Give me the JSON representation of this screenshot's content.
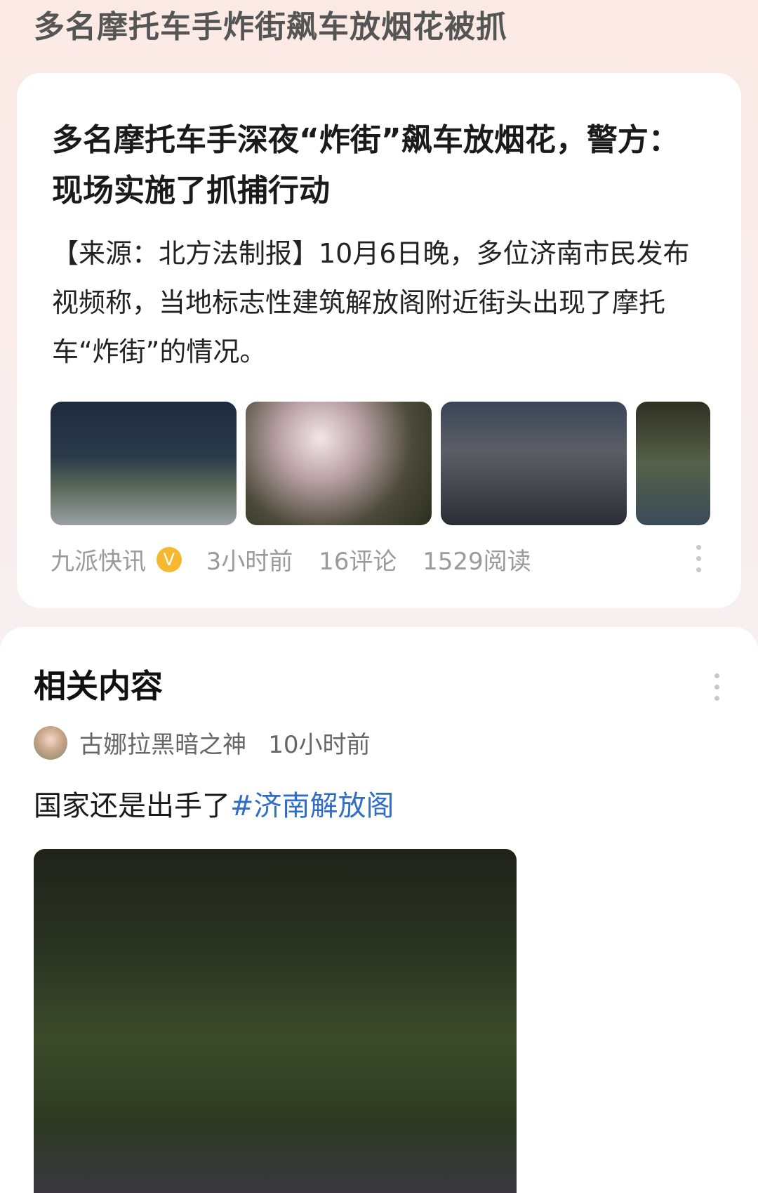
{
  "header": {
    "title": "多名摩托车手炸街飙车放烟花被抓"
  },
  "article": {
    "title": "多名摩托车手深夜“炸街”飙车放烟花，警方：现场实施了抓捕行动",
    "body": "【来源：北方法制报】10月6日晚，多位济南市民发布视频称，当地标志性建筑解放阁附近街头出现了摩托车“炸街”的情况。",
    "source": "九派快讯",
    "verified_badge": "V",
    "time": "3小时前",
    "comments": "16评论",
    "reads": "1529阅读"
  },
  "related": {
    "title": "相关内容",
    "author": "古娜拉黑暗之神",
    "time": "10小时前",
    "text": "国家还是出手了",
    "hashtag": "#济南解放阁"
  },
  "colors": {
    "hashtag": "#2f6ec4",
    "verified_badge": "#f5b82e"
  },
  "icons": {
    "more": "more-vertical-icon"
  }
}
